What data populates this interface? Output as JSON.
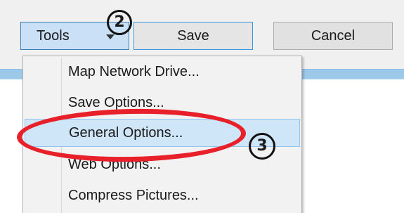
{
  "toolbar": {
    "tools_label": "Tools",
    "save_label": "Save",
    "cancel_label": "Cancel"
  },
  "menu": {
    "items": [
      {
        "label": "Map Network Drive..."
      },
      {
        "label": "Save Options..."
      },
      {
        "label": "General Options...",
        "highlighted": true
      },
      {
        "label": "Web Options..."
      },
      {
        "label": "Compress Pictures..."
      }
    ]
  },
  "annotations": {
    "step_2": "2",
    "step_3": "3",
    "highlight_color": "#e8202a"
  },
  "colors": {
    "accent_bar": "#9cc8ea",
    "tools_button_bg": "#c9e0f7",
    "menu_highlight": "#cfe5f8"
  }
}
